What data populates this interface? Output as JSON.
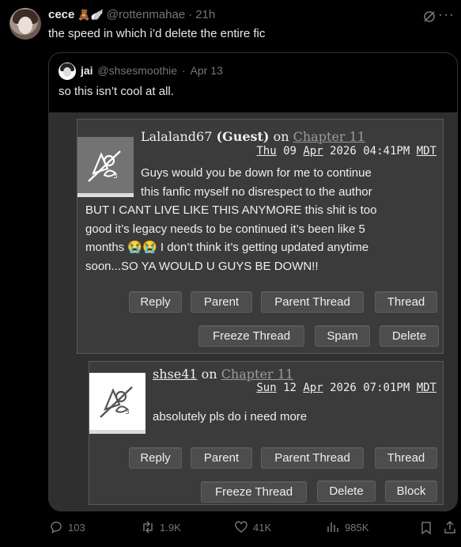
{
  "tweet": {
    "display_name": "cece",
    "emoji": "🧸🪽",
    "handle": "@rottenmahae",
    "separator": "·",
    "age": "21h",
    "text": "the speed in which i’d delete the entire fic"
  },
  "quoted": {
    "display_name": "jai",
    "handle": "@shsesmoothie",
    "separator": "·",
    "date": "Apr 13",
    "text": "so this isn’t cool at all."
  },
  "comments": [
    {
      "user": "Lalaland67",
      "guest": "(Guest)",
      "on": "on",
      "chapter": "Chapter 11",
      "day": "Thu",
      "date_num": "09",
      "month": "Apr",
      "time_rest": "2026 04:41PM",
      "tz": "MDT",
      "body_lines": [
        "Guys would you be down for me to continue",
        "this fanfic myself no disrespect to the author",
        "BUT I CANT LIVE LIKE THIS ANYMORE this shit is too",
        "good it’s legacy needs to be continued it’s been like 5",
        "months 😭😭 I don’t think it’s getting updated anytime",
        "soon...SO YA WOULD U GUYS BE DOWN!!"
      ],
      "buttons": [
        "Reply",
        "Parent",
        "Parent Thread",
        "Thread",
        "Freeze Thread",
        "Spam",
        "Delete"
      ]
    },
    {
      "user": "shse41",
      "on": "on",
      "chapter": "Chapter 11",
      "day": "Sun",
      "date_num": "12",
      "month": "Apr",
      "time_rest": "2026 07:01PM",
      "tz": "MDT",
      "body": "absolutely pls do i need more",
      "buttons": [
        "Reply",
        "Parent",
        "Parent Thread",
        "Thread",
        "Freeze Thread",
        "Delete",
        "Block"
      ]
    }
  ],
  "actions": {
    "replies": "103",
    "reposts": "1.9K",
    "likes": "41K",
    "views": "985K"
  },
  "icons": [
    "grok-icon",
    "more-icon",
    "reply-icon",
    "repost-icon",
    "like-icon",
    "views-icon",
    "bookmark-icon",
    "share-icon",
    "default-avatar-icon"
  ],
  "colors": {
    "muted": "#71767b",
    "text": "#e7e9ea",
    "panel": "#3b3b3b"
  }
}
